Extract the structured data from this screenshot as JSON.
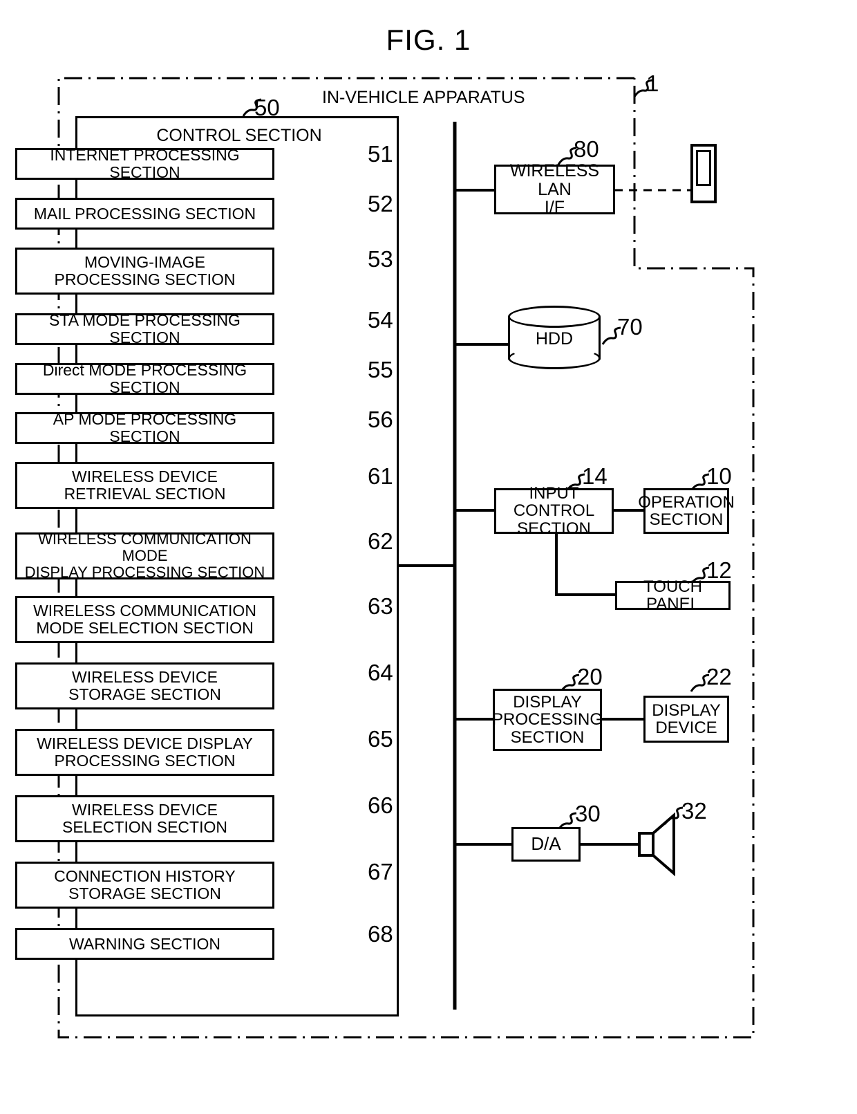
{
  "figure": {
    "title": "FIG. 1",
    "apparatus_label": "IN-VEHICLE APPARATUS",
    "apparatus_ref": "1"
  },
  "control_section": {
    "title": "CONTROL SECTION",
    "ref": "50",
    "units": [
      {
        "ref": "51",
        "label": "INTERNET PROCESSING SECTION"
      },
      {
        "ref": "52",
        "label": "MAIL PROCESSING SECTION"
      },
      {
        "ref": "53",
        "label": "MOVING-IMAGE\nPROCESSING SECTION"
      },
      {
        "ref": "54",
        "label": "STA MODE PROCESSING SECTION"
      },
      {
        "ref": "55",
        "label": "Direct MODE PROCESSING SECTION"
      },
      {
        "ref": "56",
        "label": "AP MODE PROCESSING SECTION"
      },
      {
        "ref": "61",
        "label": "WIRELESS DEVICE\nRETRIEVAL SECTION"
      },
      {
        "ref": "62",
        "label": "WIRELESS COMMUNICATION MODE\nDISPLAY PROCESSING SECTION"
      },
      {
        "ref": "63",
        "label": "WIRELESS COMMUNICATION\nMODE SELECTION SECTION"
      },
      {
        "ref": "64",
        "label": "WIRELESS DEVICE\nSTORAGE SECTION"
      },
      {
        "ref": "65",
        "label": "WIRELESS DEVICE DISPLAY\nPROCESSING SECTION"
      },
      {
        "ref": "66",
        "label": "WIRELESS DEVICE\nSELECTION SECTION"
      },
      {
        "ref": "67",
        "label": "CONNECTION HISTORY\nSTORAGE SECTION"
      },
      {
        "ref": "68",
        "label": "WARNING SECTION"
      }
    ]
  },
  "peripherals": {
    "wireless_lan": {
      "ref": "80",
      "label": "WIRELESS LAN\nI/F"
    },
    "hdd": {
      "ref": "70",
      "label": "HDD"
    },
    "input_control": {
      "ref": "14",
      "label": "INPUT CONTROL\nSECTION"
    },
    "operation": {
      "ref": "10",
      "label": "OPERATION\nSECTION"
    },
    "touch_panel": {
      "ref": "12",
      "label": "TOUCH PANEL"
    },
    "display_processing": {
      "ref": "20",
      "label": "DISPLAY\nPROCESSING\nSECTION"
    },
    "display_device": {
      "ref": "22",
      "label": "DISPLAY\nDEVICE"
    },
    "da_converter": {
      "ref": "30",
      "label": "D/A"
    },
    "speaker": {
      "ref": "32",
      "label": ""
    },
    "mobile_device": {
      "ref": "",
      "label": ""
    }
  },
  "colors": {
    "line": "#000000",
    "background": "#ffffff"
  }
}
